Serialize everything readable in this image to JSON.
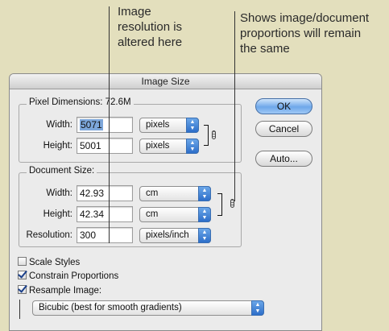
{
  "annotations": {
    "left": [
      "Image",
      "resolution is",
      "altered here"
    ],
    "right": [
      "Shows image/document",
      "proportions will remain",
      "the same"
    ]
  },
  "dialog": {
    "title": "Image Size",
    "pixel_dimensions": {
      "label": "Pixel Dimensions:",
      "size": "72.6M",
      "width_label": "Width:",
      "width_value": "5071",
      "width_unit": "pixels",
      "height_label": "Height:",
      "height_value": "5001",
      "height_unit": "pixels"
    },
    "document_size": {
      "label": "Document Size:",
      "width_label": "Width:",
      "width_value": "42.93",
      "width_unit": "cm",
      "height_label": "Height:",
      "height_value": "42.34",
      "height_unit": "cm",
      "resolution_label": "Resolution:",
      "resolution_value": "300",
      "resolution_unit": "pixels/inch"
    },
    "buttons": {
      "ok": "OK",
      "cancel": "Cancel",
      "auto": "Auto..."
    },
    "options": {
      "scale_styles": {
        "label": "Scale Styles",
        "checked": false
      },
      "constrain_proportions": {
        "label": "Constrain Proportions",
        "checked": true
      },
      "resample_image": {
        "label": "Resample Image:",
        "checked": true
      }
    },
    "resample_method": "Bicubic (best for smooth gradients)"
  },
  "colors": {
    "background": "#e3dfbd",
    "accent": "#6ea8ea",
    "selection": "#7da7db"
  }
}
